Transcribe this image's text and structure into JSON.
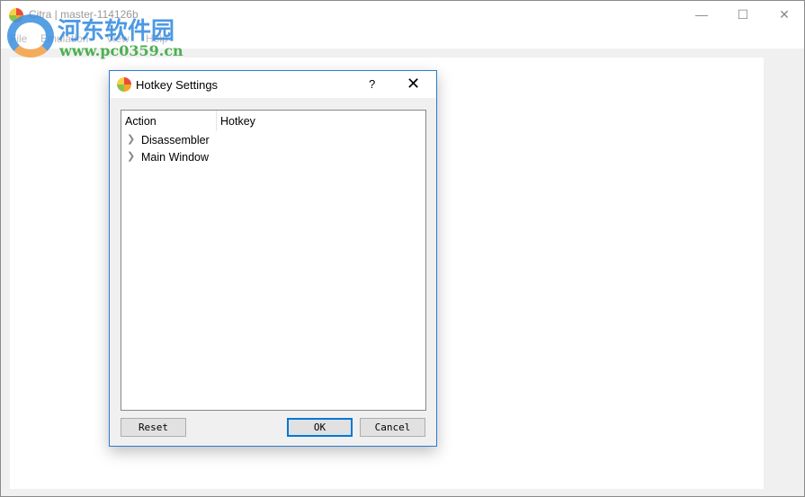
{
  "window": {
    "title": "Citra | master-114126b",
    "minimize_icon": "minimize-icon",
    "maximize_icon": "maximize-icon",
    "close_icon": "close-icon"
  },
  "menu": [
    "File",
    "Emulation",
    "View",
    "Help"
  ],
  "watermark": {
    "line1": "河东软件园",
    "line2": "www.pc0359.cn"
  },
  "dialog": {
    "title": "Hotkey Settings",
    "help": "?",
    "close": "✕",
    "columns": [
      "Action",
      "Hotkey"
    ],
    "rows": [
      {
        "label": "Disassembler",
        "expanded": false
      },
      {
        "label": "Main Window",
        "expanded": false
      }
    ],
    "buttons": {
      "reset": "Reset",
      "ok": "OK",
      "cancel": "Cancel"
    }
  },
  "colors": {
    "accent": "#0078d7",
    "dialog_border": "#2b7bd1"
  }
}
